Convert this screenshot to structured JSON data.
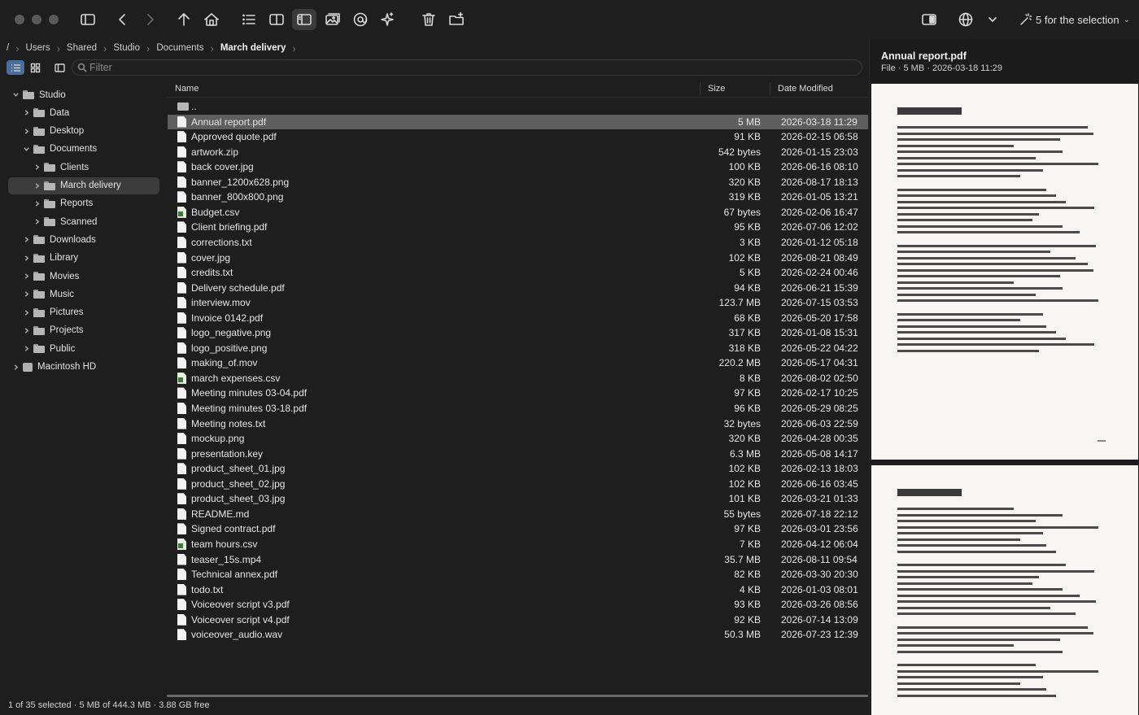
{
  "toolbar": {
    "selection_label": "5 for the selection"
  },
  "breadcrumb": {
    "root": "/",
    "items": [
      "Users",
      "Shared",
      "Studio",
      "Documents"
    ],
    "current": "March delivery"
  },
  "filter": {
    "placeholder": "Filter"
  },
  "sidebar": {
    "items": [
      {
        "label": "Studio",
        "depth": 0,
        "expanded": true
      },
      {
        "label": "Data",
        "depth": 1,
        "expanded": false
      },
      {
        "label": "Desktop",
        "depth": 1,
        "expanded": false
      },
      {
        "label": "Documents",
        "depth": 1,
        "expanded": true
      },
      {
        "label": "Clients",
        "depth": 2,
        "expanded": false
      },
      {
        "label": "March delivery",
        "depth": 2,
        "expanded": false,
        "selected": true
      },
      {
        "label": "Reports",
        "depth": 2,
        "expanded": false
      },
      {
        "label": "Scanned",
        "depth": 2,
        "expanded": false
      },
      {
        "label": "Downloads",
        "depth": 1,
        "expanded": false
      },
      {
        "label": "Library",
        "depth": 1,
        "expanded": false
      },
      {
        "label": "Movies",
        "depth": 1,
        "expanded": false
      },
      {
        "label": "Music",
        "depth": 1,
        "expanded": false
      },
      {
        "label": "Pictures",
        "depth": 1,
        "expanded": false
      },
      {
        "label": "Projects",
        "depth": 1,
        "expanded": false
      },
      {
        "label": "Public",
        "depth": 1,
        "expanded": false
      },
      {
        "label": "Macintosh HD",
        "depth": 0,
        "expanded": false,
        "drive": true
      }
    ]
  },
  "columns": {
    "name": "Name",
    "size": "Size",
    "date": "Date Modified"
  },
  "files": [
    {
      "name": "..",
      "size": "",
      "date": "",
      "kind": "dir"
    },
    {
      "name": "Annual report.pdf",
      "size": "5 MB",
      "date": "2026-03-18 11:29",
      "kind": "doc",
      "selected": true
    },
    {
      "name": "Approved quote.pdf",
      "size": "91 KB",
      "date": "2026-02-15 06:58",
      "kind": "doc"
    },
    {
      "name": "artwork.zip",
      "size": "542 bytes",
      "date": "2026-01-15 23:03",
      "kind": "doc"
    },
    {
      "name": "back cover.jpg",
      "size": "100 KB",
      "date": "2026-06-16 08:10",
      "kind": "doc"
    },
    {
      "name": "banner_1200x628.png",
      "size": "320 KB",
      "date": "2026-08-17 18:13",
      "kind": "doc"
    },
    {
      "name": "banner_800x800.png",
      "size": "319 KB",
      "date": "2026-01-05 13:21",
      "kind": "doc"
    },
    {
      "name": "Budget.csv",
      "size": "67 bytes",
      "date": "2026-02-06 16:47",
      "kind": "csv"
    },
    {
      "name": "Client briefing.pdf",
      "size": "95 KB",
      "date": "2026-07-06 12:02",
      "kind": "doc"
    },
    {
      "name": "corrections.txt",
      "size": "3 KB",
      "date": "2026-01-12 05:18",
      "kind": "doc"
    },
    {
      "name": "cover.jpg",
      "size": "102 KB",
      "date": "2026-08-21 08:49",
      "kind": "doc"
    },
    {
      "name": "credits.txt",
      "size": "5 KB",
      "date": "2026-02-24 00:46",
      "kind": "doc"
    },
    {
      "name": "Delivery schedule.pdf",
      "size": "94 KB",
      "date": "2026-06-21 15:39",
      "kind": "doc"
    },
    {
      "name": "interview.mov",
      "size": "123.7 MB",
      "date": "2026-07-15 03:53",
      "kind": "doc"
    },
    {
      "name": "Invoice 0142.pdf",
      "size": "68 KB",
      "date": "2026-05-20 17:58",
      "kind": "doc"
    },
    {
      "name": "logo_negative.png",
      "size": "317 KB",
      "date": "2026-01-08 15:31",
      "kind": "doc"
    },
    {
      "name": "logo_positive.png",
      "size": "318 KB",
      "date": "2026-05-22 04:22",
      "kind": "doc"
    },
    {
      "name": "making_of.mov",
      "size": "220.2 MB",
      "date": "2026-05-17 04:31",
      "kind": "doc"
    },
    {
      "name": "march expenses.csv",
      "size": "8 KB",
      "date": "2026-08-02 02:50",
      "kind": "csv"
    },
    {
      "name": "Meeting minutes 03-04.pdf",
      "size": "97 KB",
      "date": "2026-02-17 10:25",
      "kind": "doc"
    },
    {
      "name": "Meeting minutes 03-18.pdf",
      "size": "96 KB",
      "date": "2026-05-29 08:25",
      "kind": "doc"
    },
    {
      "name": "Meeting notes.txt",
      "size": "32 bytes",
      "date": "2026-06-03 22:59",
      "kind": "doc"
    },
    {
      "name": "mockup.png",
      "size": "320 KB",
      "date": "2026-04-28 00:35",
      "kind": "doc"
    },
    {
      "name": "presentation.key",
      "size": "6.3 MB",
      "date": "2026-05-08 14:17",
      "kind": "doc"
    },
    {
      "name": "product_sheet_01.jpg",
      "size": "102 KB",
      "date": "2026-02-13 18:03",
      "kind": "doc"
    },
    {
      "name": "product_sheet_02.jpg",
      "size": "102 KB",
      "date": "2026-06-16 03:45",
      "kind": "doc"
    },
    {
      "name": "product_sheet_03.jpg",
      "size": "101 KB",
      "date": "2026-03-21 01:33",
      "kind": "doc"
    },
    {
      "name": "README.md",
      "size": "55 bytes",
      "date": "2026-07-18 22:12",
      "kind": "doc"
    },
    {
      "name": "Signed contract.pdf",
      "size": "97 KB",
      "date": "2026-03-01 23:56",
      "kind": "doc"
    },
    {
      "name": "team hours.csv",
      "size": "7 KB",
      "date": "2026-04-12 06:04",
      "kind": "csv"
    },
    {
      "name": "teaser_15s.mp4",
      "size": "35.7 MB",
      "date": "2026-08-11 09:54",
      "kind": "doc"
    },
    {
      "name": "Technical annex.pdf",
      "size": "82 KB",
      "date": "2026-03-30 20:30",
      "kind": "doc"
    },
    {
      "name": "todo.txt",
      "size": "4 KB",
      "date": "2026-01-03 08:01",
      "kind": "doc"
    },
    {
      "name": "Voiceover script v3.pdf",
      "size": "93 KB",
      "date": "2026-03-26 08:56",
      "kind": "doc"
    },
    {
      "name": "Voiceover script v4.pdf",
      "size": "92 KB",
      "date": "2026-07-14 13:09",
      "kind": "doc"
    },
    {
      "name": "voiceover_audio.wav",
      "size": "50.3 MB",
      "date": "2026-07-23 12:39",
      "kind": "doc"
    }
  ],
  "status": {
    "text": "1 of 35 selected · 5 MB of 444.3 MB · 3.88 GB free"
  },
  "preview": {
    "title": "Annual report.pdf",
    "meta": "File  ·  5 MB  ·  2026-03-18 11:29"
  },
  "icons": {
    "toolbar": [
      "sidebar-toggle-icon",
      "back-icon",
      "forward-icon",
      "up-icon",
      "home-icon",
      "list-icon",
      "split-view-icon",
      "preview-pane-icon",
      "image-icon",
      "at-icon",
      "sparkle-icon",
      "trash-icon",
      "new-folder-icon",
      "panel-right-icon",
      "globe-icon",
      "chevron-down-icon",
      "magic-wand-icon"
    ]
  },
  "colors": {
    "selection": "#5e5e5e",
    "accent": "#4a6f9c",
    "background": "#1e1e1e"
  }
}
